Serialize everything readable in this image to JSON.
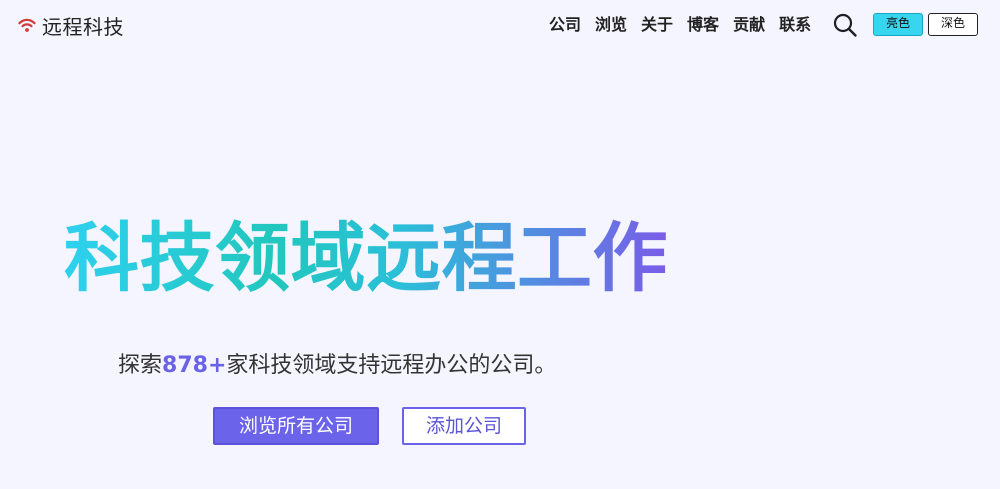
{
  "header": {
    "brand_name": "远程科技",
    "brand_icon": "wifi-icon",
    "brand_color": "#d33b3b",
    "nav": [
      {
        "label": "公司"
      },
      {
        "label": "浏览"
      },
      {
        "label": "关于"
      },
      {
        "label": "博客"
      },
      {
        "label": "贡献"
      },
      {
        "label": "联系"
      }
    ],
    "search_icon": "search-icon",
    "theme": {
      "light_label": "亮色",
      "dark_label": "深色",
      "selected": "light"
    }
  },
  "hero": {
    "title": "科技领域远程工作",
    "subtitle_prefix": "探索",
    "count": "878+",
    "subtitle_suffix": "家科技领域支持远程办公的公司。",
    "primary_button": "浏览所有公司",
    "secondary_button": "添加公司"
  },
  "colors": {
    "background": "#f5f5ff",
    "accent": "#6c63eb",
    "cyan": "#38d5f0",
    "teal": "#21c7bd"
  }
}
